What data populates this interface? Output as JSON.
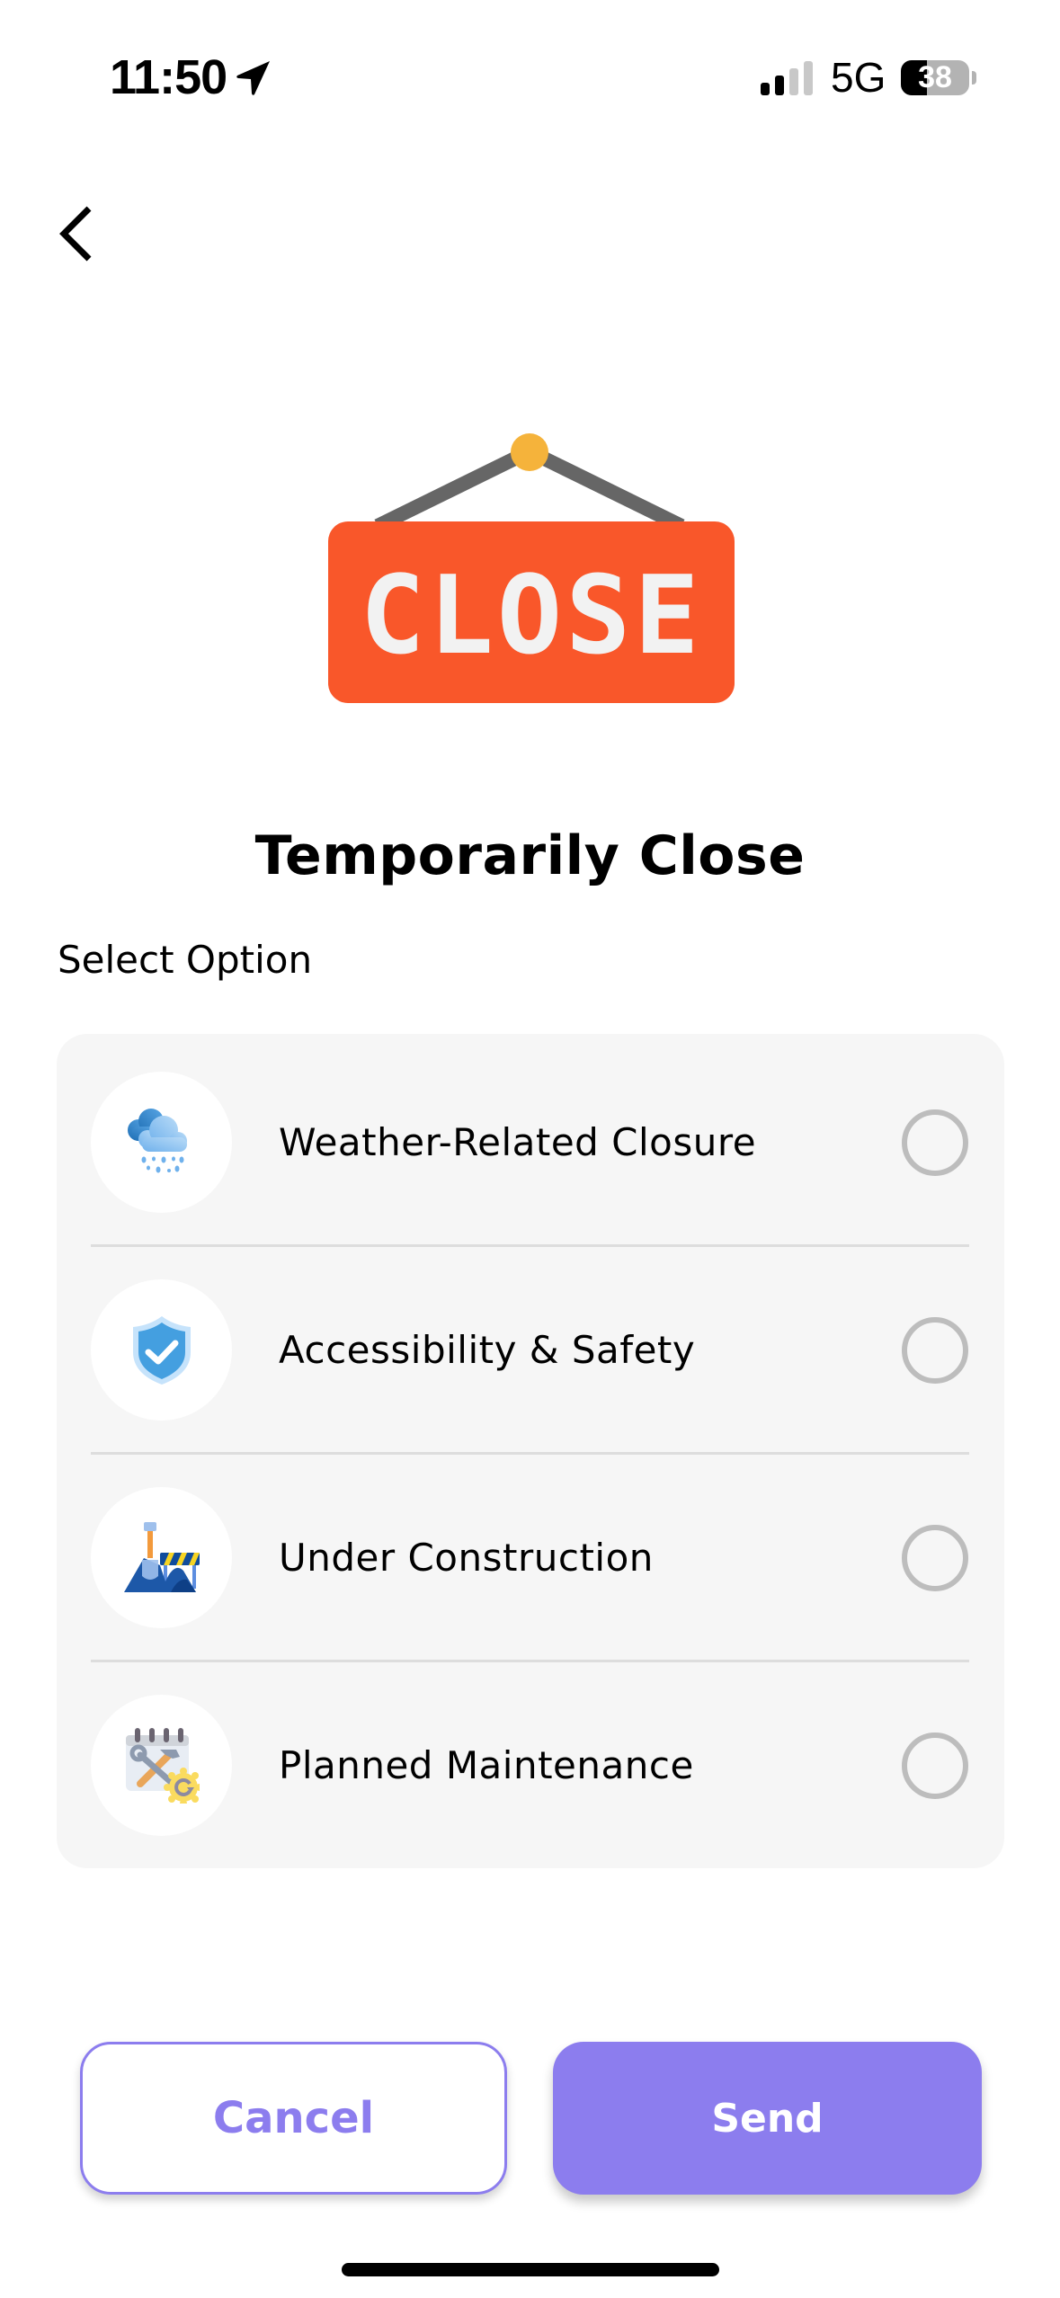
{
  "status_bar": {
    "time": "11:50",
    "location_icon": "location-arrow-icon",
    "signal_bars_active": 2,
    "signal_bars_total": 4,
    "network": "5G",
    "battery_percent": 38,
    "battery_label": "38"
  },
  "header": {
    "back_icon": "chevron-left-icon"
  },
  "illustration": {
    "icon": "close-sign-icon",
    "sign_text": "CLOSE",
    "colors": {
      "board": "#F9572A",
      "text": "#F2F2F2",
      "string": "#666666",
      "pin": "#F5B33B"
    }
  },
  "page": {
    "title": "Temporarily Close",
    "section_label": "Select Option"
  },
  "options": [
    {
      "label": "Weather-Related Closure",
      "icon": "rain-cloud-icon",
      "selected": false
    },
    {
      "label": "Accessibility & Safety",
      "icon": "shield-check-icon",
      "selected": false
    },
    {
      "label": "Under Construction",
      "icon": "construction-shovel-icon",
      "selected": false
    },
    {
      "label": "Planned Maintenance",
      "icon": "calendar-tools-icon",
      "selected": false
    }
  ],
  "actions": {
    "cancel_label": "Cancel",
    "send_label": "Send"
  },
  "theme": {
    "accent": "#8C7DEE",
    "card_background": "#F6F6F6",
    "radio_border": "#BDBDBD",
    "divider": "#DDDDDD"
  }
}
